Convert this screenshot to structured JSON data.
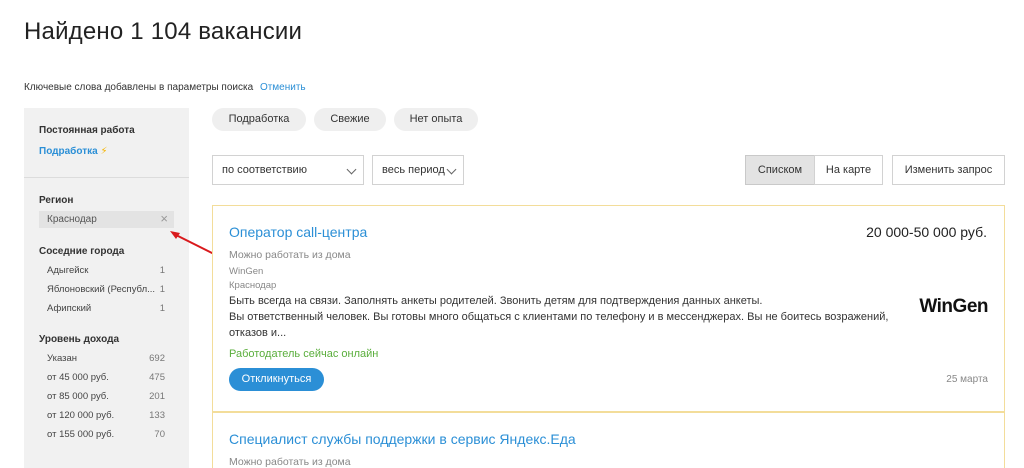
{
  "header": {
    "title": "Найдено 1 104 вакансии",
    "keywords_note": "Ключевые слова добавлены в параметры поиска",
    "cancel_link": "Отменить"
  },
  "sidebar": {
    "employment_head": "Постоянная работа",
    "employment_link": "Подработка",
    "employment_icon": "lightning-icon",
    "region_head": "Регион",
    "region_value": "Краснодар",
    "nearby_head": "Соседние города",
    "nearby": [
      {
        "name": "Адыгейск",
        "count": "1"
      },
      {
        "name": "Яблоновский (Республ...",
        "count": "1"
      },
      {
        "name": "Афипский",
        "count": "1"
      }
    ],
    "income_head": "Уровень дохода",
    "income": [
      {
        "name": "Указан",
        "count": "692"
      },
      {
        "name": "от 45 000 руб.",
        "count": "475"
      },
      {
        "name": "от 85 000 руб.",
        "count": "201"
      },
      {
        "name": "от 120 000 руб.",
        "count": "133"
      },
      {
        "name": "от 155 000 руб.",
        "count": "70"
      }
    ]
  },
  "chips": [
    "Подработка",
    "Свежие",
    "Нет опыта"
  ],
  "controls": {
    "sort": "по соответствию",
    "period": "весь период",
    "view_list": "Списком",
    "view_map": "На карте",
    "change_query": "Изменить запрос"
  },
  "vacancies": [
    {
      "title": "Оператор call-центра",
      "salary": "20 000-50 000 руб.",
      "remote": "Можно работать из дома",
      "company": "WinGen",
      "city": "Краснодар",
      "snippet_1": "Быть всегда на связи. Заполнять анкеты родителей. Звонить детям для подтверждения данных анкеты.",
      "snippet_2": "Вы ответственный человек. Вы готовы много общаться с клиентами по телефону и в мессенджерах. Вы не боитесь возражений,",
      "snippet_3": "отказов и...",
      "online": "Работодатель сейчас онлайн",
      "apply": "Откликнуться",
      "date": "25 марта",
      "logo": "WinGen"
    },
    {
      "title": "Специалист службы поддержки в сервис Яндекс.Еда",
      "remote": "Можно работать из дома"
    }
  ],
  "colors": {
    "accent": "#2b8fd6",
    "online": "#5aae3c",
    "card_border": "#f3dd9a",
    "annotation_arrow": "#d9191c"
  }
}
